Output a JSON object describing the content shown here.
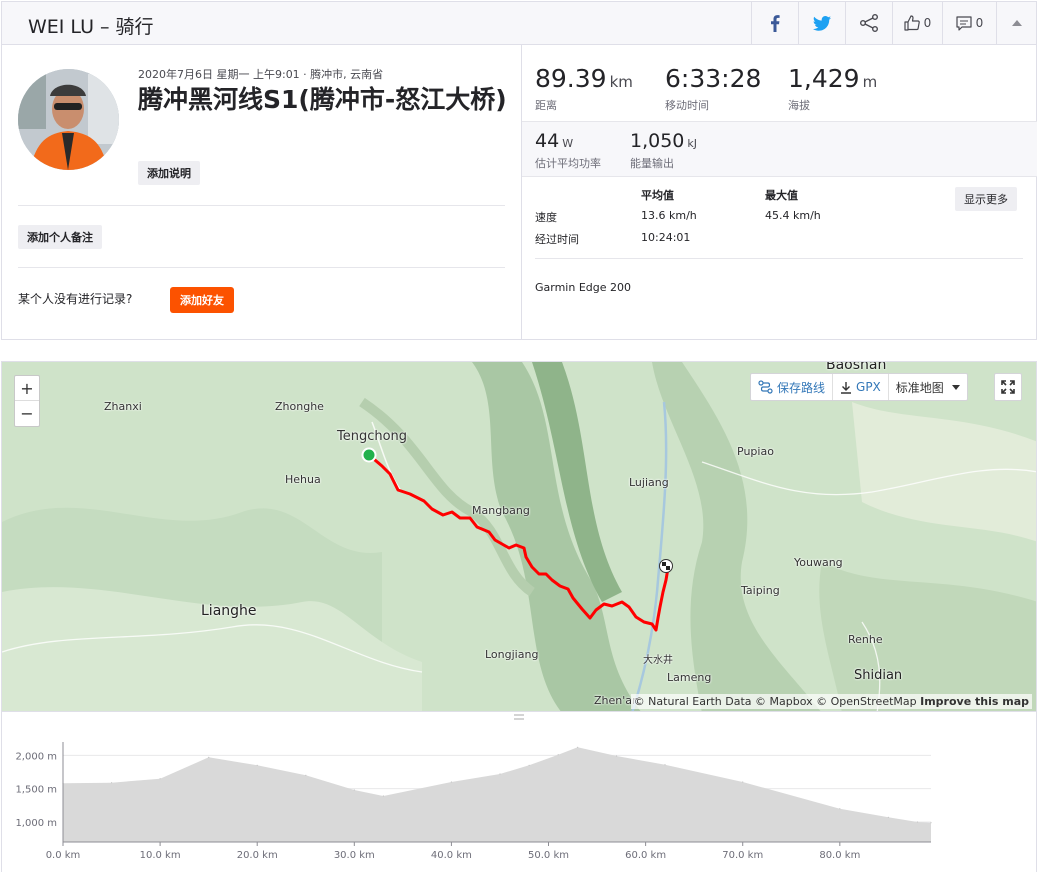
{
  "header": {
    "title": "WEI LU – 骑行",
    "kudos_count": "0",
    "comment_count": "0"
  },
  "summary": {
    "meta": "2020年7月6日 星期一 上午9:01 · 腾冲市, 云南省",
    "title": "腾冲黑河线S1(腾冲市-怒江大桥)",
    "add_description": "添加说明",
    "add_private_note": "添加个人备注",
    "no_record_prompt": "某个人没有进行记录?",
    "add_friend": "添加好友"
  },
  "stats": {
    "distance": {
      "value": "89.39",
      "unit": "km",
      "label": "距离"
    },
    "moving_time": {
      "value": "6:33:28",
      "label": "移动时间"
    },
    "elevation": {
      "value": "1,429",
      "unit": "m",
      "label": "海拔"
    },
    "power": {
      "value": "44",
      "unit": "W",
      "label": "估计平均功率"
    },
    "energy": {
      "value": "1,050",
      "unit": "kJ",
      "label": "能量输出"
    },
    "table": {
      "col_avg": "平均值",
      "col_max": "最大值",
      "speed_label": "速度",
      "speed_avg": "13.6 km/h",
      "speed_max": "45.4 km/h",
      "elapsed_label": "经过时间",
      "elapsed_value": "10:24:01"
    },
    "show_more": "显示更多",
    "device": "Garmin Edge 200"
  },
  "map": {
    "places": {
      "baoshan": "Baoshan",
      "zhanxi": "Zhanxi",
      "zhonghe": "Zhonghe",
      "tengchong": "Tengchong",
      "hehua": "Hehua",
      "mangbang": "Mangbang",
      "lujiang": "Lujiang",
      "pupiao": "Pupiao",
      "youwang": "Youwang",
      "taiping": "Taiping",
      "lianghe": "Lianghe",
      "longjiang": "Longjiang",
      "dashuijing": "大水井",
      "lameng": "Lameng",
      "renhe": "Renhe",
      "shidian": "Shidian",
      "zhenan": "Zhen'an"
    },
    "zoom_in": "+",
    "zoom_out": "−",
    "save_route": "保存路线",
    "gpx": "GPX",
    "map_style": "标准地图",
    "attribution_a": "© Natural Earth Data © Mapbox © OpenStreetMap",
    "attribution_b": "Improve this map",
    "route_color": "#ff0000",
    "start_color": "#22b14c"
  },
  "chart_data": {
    "type": "area",
    "x": [
      0,
      5,
      10,
      15,
      20,
      25,
      30,
      33,
      40,
      45,
      48,
      51,
      53,
      57,
      62,
      70,
      80,
      85,
      88,
      89.39
    ],
    "y": [
      1580,
      1590,
      1650,
      1970,
      1850,
      1700,
      1480,
      1390,
      1600,
      1720,
      1850,
      2010,
      2120,
      1990,
      1860,
      1600,
      1200,
      1070,
      1000,
      990
    ],
    "xlabel": "",
    "ylabel": "",
    "xticks": [
      "0.0 km",
      "10.0 km",
      "20.0 km",
      "30.0 km",
      "40.0 km",
      "50.0 km",
      "60.0 km",
      "70.0 km",
      "80.0 km"
    ],
    "yticks": [
      "1,000 m",
      "1,500 m",
      "2,000 m"
    ],
    "xlim": [
      0,
      89.39
    ],
    "ylim": [
      700,
      2200
    ],
    "fill_color": "#d9d9d9"
  }
}
